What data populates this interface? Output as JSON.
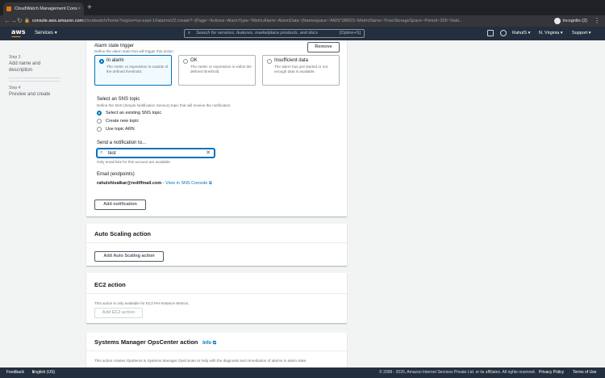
{
  "browser": {
    "tab_title": "CloudWatch Management Cons",
    "url_host": "console.aws.amazon.com",
    "url_path": "/cloudwatch/home?region=us-east-1#alarmsV2:create?~(Page~'Actions~AlarmType~'MetricAlarm~AlarmData~(Namespace~'AWS*2fRDS~MetricName~'FreeStorageSpace~Period~300~Stati...",
    "incognito_label": "Incognito (2)"
  },
  "aws_nav": {
    "logo": "aws",
    "services_label": "Services",
    "search_placeholder": "Search for services, features, marketplace products, and docs",
    "search_shortcut": "[Option+S]",
    "user": "RahulS",
    "region": "N. Virginia",
    "support": "Support"
  },
  "sidebar": {
    "step3_label": "Step 3",
    "step3_text_line1": "Add name and",
    "step3_text_line2": "description",
    "step4_label": "Step 4",
    "step4_text": "Preview and create"
  },
  "notification": {
    "alarm_state_title": "Alarm state trigger",
    "alarm_state_desc": "Define the alarm state that will trigger this action.",
    "remove_label": "Remove",
    "tiles": [
      {
        "title": "In alarm",
        "desc": "The metric or expression is outside of the defined threshold.",
        "selected": true
      },
      {
        "title": "OK",
        "desc": "The metric or expression is within the defined threshold.",
        "selected": false
      },
      {
        "title": "Insufficient data",
        "desc": "The alarm has just started or not enough data is available.",
        "selected": false
      }
    ],
    "sns_title": "Select an SNS topic",
    "sns_desc": "Define the SNS (Simple Notification Service) topic that will receive the notification.",
    "sns_options": [
      {
        "label": "Select an existing SNS topic",
        "selected": true
      },
      {
        "label": "Create new topic",
        "selected": false
      },
      {
        "label": "Use topic ARN",
        "selected": false
      }
    ],
    "send_to_label": "Send a notification to...",
    "send_to_value": "test",
    "send_to_hint": "Only email lists for this account are available.",
    "email_label": "Email (endpoints)",
    "email_value": "rahulshivalkar@rediffmail.com",
    "email_sep": " - ",
    "view_sns_link": "View in SNS Console",
    "add_notification_label": "Add notification"
  },
  "autoscaling": {
    "title": "Auto Scaling action",
    "button_label": "Add Auto Scaling action"
  },
  "ec2": {
    "title": "EC2 action",
    "desc": "This action is only available for EC2 Per-Instance Metrics.",
    "button_label": "Add EC2 action"
  },
  "ssm": {
    "title": "Systems Manager OpsCenter action",
    "info_label": "Info",
    "desc": "This action creates OpsItems in Systems Manager OpsCenter to help with the diagnosis and remediation of alarms in alarm state."
  },
  "footer": {
    "feedback": "Feedback",
    "language": "English (US)",
    "copyright": "© 2008 - 2020, Amazon Internet Services Private Ltd. or its affiliates. All rights reserved.",
    "privacy": "Privacy Policy",
    "terms": "Terms of Use"
  }
}
